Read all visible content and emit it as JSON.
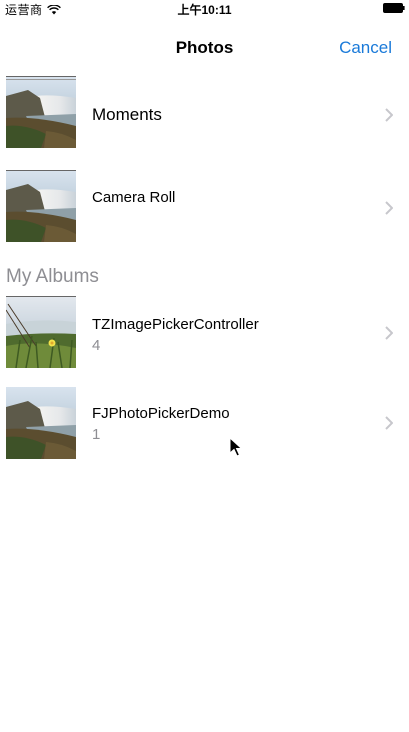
{
  "status_bar": {
    "carrier": "运营商",
    "time": "上午10:11"
  },
  "nav": {
    "title": "Photos",
    "cancel": "Cancel"
  },
  "albums": [
    {
      "title": "Moments",
      "count": ""
    },
    {
      "title": "Camera Roll",
      "count": ""
    }
  ],
  "section": {
    "header": "My Albums"
  },
  "my_albums": [
    {
      "title": "TZImagePickerController",
      "count": "4"
    },
    {
      "title": "FJPhotoPickerDemo",
      "count": "1"
    }
  ],
  "colors": {
    "accent": "#1a7ad9",
    "secondary_text": "#8e8e93",
    "chevron": "#c7c7cc"
  },
  "icons": [
    "wifi-icon",
    "battery-icon",
    "chevron-right-icon",
    "cursor-icon"
  ]
}
